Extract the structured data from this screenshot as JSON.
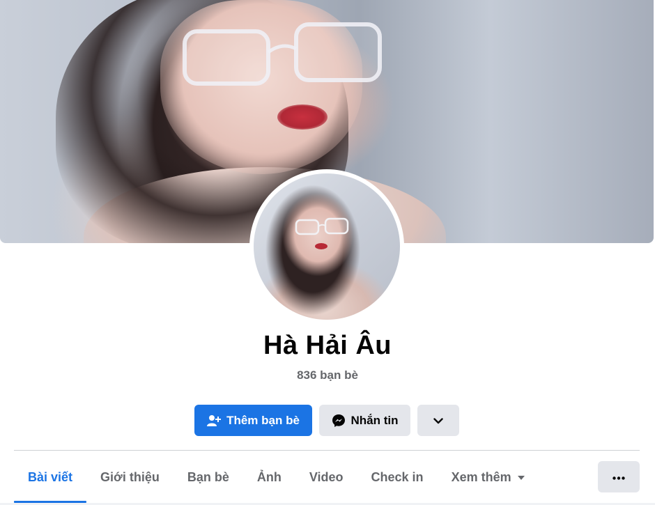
{
  "profile": {
    "name": "Hà Hải Âu",
    "friends_count": "836 bạn bè"
  },
  "actions": {
    "add_friend_label": "Thêm bạn bè",
    "message_label": "Nhắn tin",
    "add_friend_icon": "user-plus-icon",
    "message_icon": "messenger-icon",
    "more_icon": "chevron-down-icon"
  },
  "tabs": [
    {
      "label": "Bài viết",
      "active": true
    },
    {
      "label": "Giới thiệu",
      "active": false
    },
    {
      "label": "Bạn bè",
      "active": false
    },
    {
      "label": "Ảnh",
      "active": false
    },
    {
      "label": "Video",
      "active": false
    },
    {
      "label": "Check in",
      "active": false
    },
    {
      "label": "Xem thêm",
      "active": false
    }
  ],
  "tab_overflow_icon": "ellipsis-icon",
  "colors": {
    "accent": "#1b74e4",
    "secondary_button": "#e4e6eb",
    "muted_text": "#65676b",
    "text": "#050505"
  }
}
